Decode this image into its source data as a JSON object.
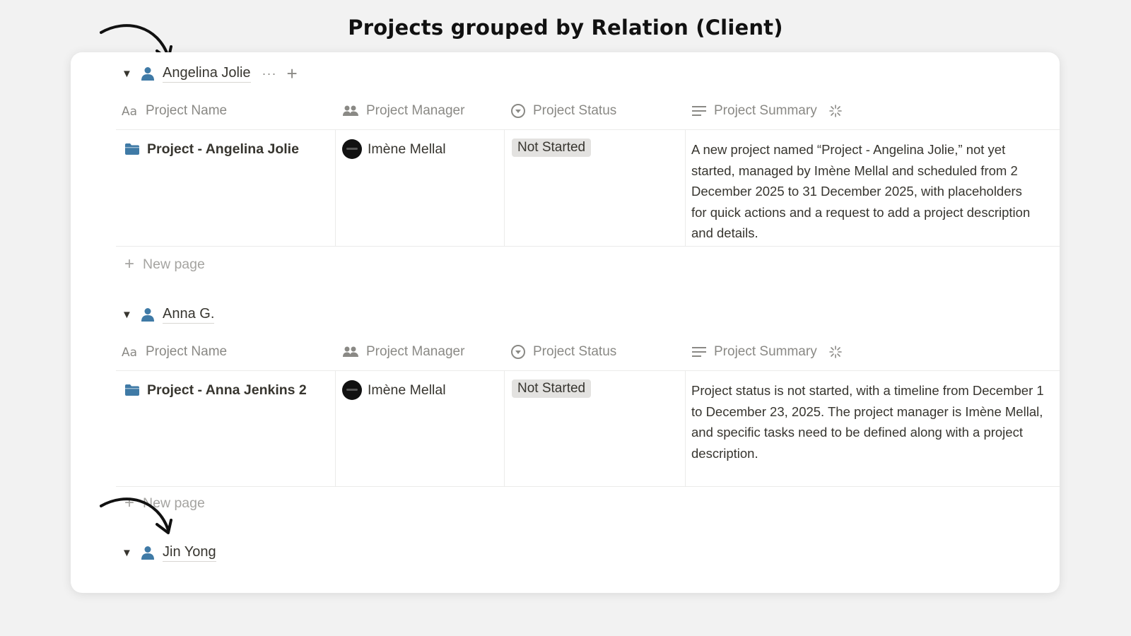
{
  "page_title": "Projects grouped by Relation (Client)",
  "columns": {
    "name": "Project Name",
    "manager": "Project Manager",
    "status": "Project Status",
    "summary": "Project Summary"
  },
  "new_page_label": "New page",
  "groups": [
    {
      "client": "Angelina Jolie",
      "row": {
        "name": "Project - Angelina Jolie",
        "manager": "Imène Mellal",
        "status": "Not Started",
        "summary": "A new project named “Project - Angelina Jolie,” not yet started, managed by Imène Mellal and scheduled from 2 December 2025 to 31 December 2025, with placeholders for quick actions and a request to add a project description and details."
      }
    },
    {
      "client": "Anna G.",
      "row": {
        "name": "Project - Anna Jenkins 2",
        "manager": "Imène Mellal",
        "status": "Not Started",
        "summary": "Project status is not started, with a timeline from December 1 to December 23, 2025. The project manager is Imène Mellal, and specific tasks need to be defined along with a project description."
      }
    },
    {
      "client": "Jin Yong"
    }
  ],
  "colors": {
    "person_icon": "#3f7aa6",
    "folder_icon": "#3f7aa6",
    "status_bg": "#e3e2e0",
    "muted_text": "#8a8985"
  }
}
